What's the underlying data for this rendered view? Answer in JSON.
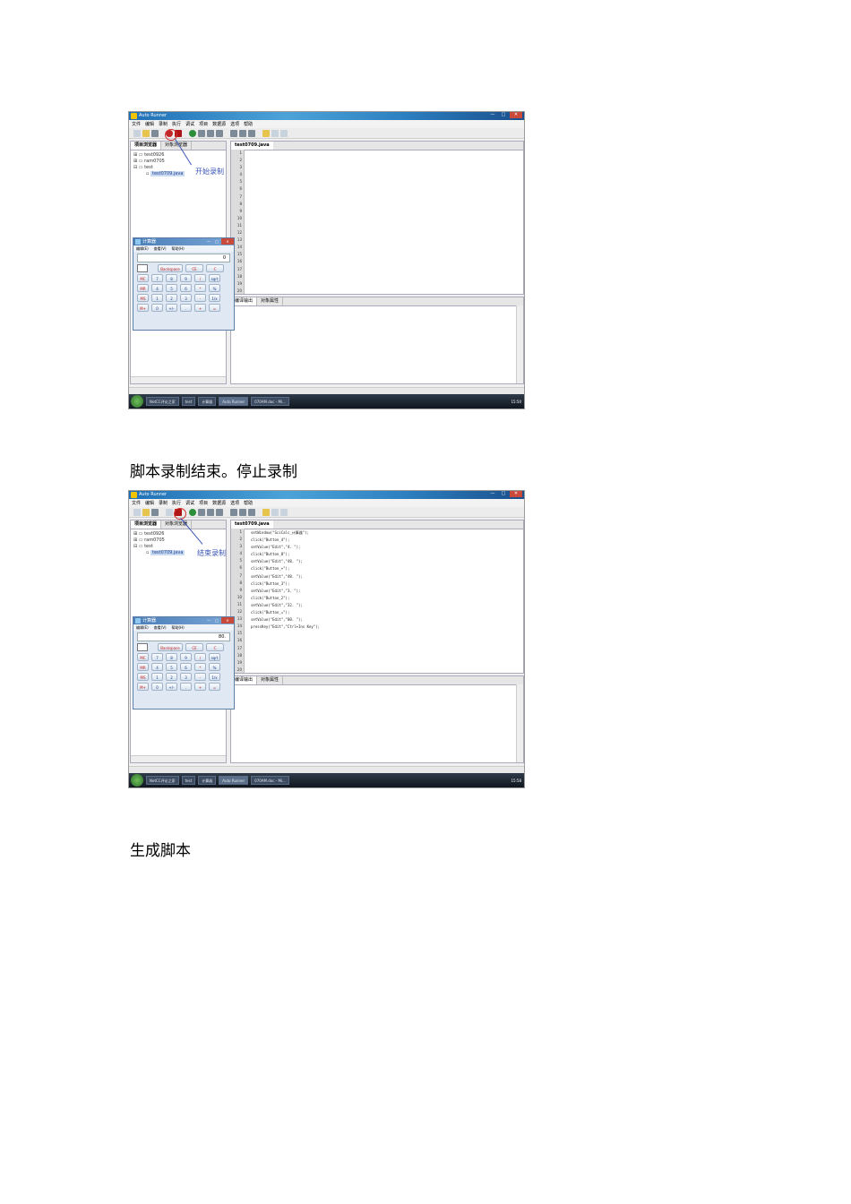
{
  "screenshots": [
    {
      "app_title": "Auto Runner",
      "window_buttons": [
        "—",
        "□",
        "✕"
      ],
      "menu": [
        "文件",
        "编辑",
        "录制",
        "执行",
        "调试",
        "项目",
        "数据源",
        "选项",
        "帮助"
      ],
      "left_tabs": [
        "项目浏览器",
        "对象浏览器"
      ],
      "tree": [
        "test0926",
        "ram0705",
        "test",
        "test0709.java"
      ],
      "editor_tab": "test0709.java",
      "line_numbers": [
        "1",
        "2",
        "3",
        "4",
        "5",
        "6",
        "7",
        "8",
        "9",
        "10",
        "11",
        "12",
        "13",
        "14",
        "15",
        "16",
        "17",
        "18",
        "19",
        "20"
      ],
      "code_lines": [],
      "output_tabs": [
        "编译输出",
        "对象属性"
      ],
      "annotation": "开始录制",
      "calculator": {
        "title": "计算器",
        "menu": [
          "编辑(E)",
          "查看(V)",
          "帮助(H)"
        ],
        "display": "0",
        "row0": [
          "Backspace",
          "CE",
          "C"
        ],
        "rows": [
          [
            "MC",
            "7",
            "8",
            "9",
            "/",
            "sqrt"
          ],
          [
            "MR",
            "4",
            "5",
            "6",
            "*",
            "%"
          ],
          [
            "MS",
            "1",
            "2",
            "3",
            "-",
            "1/x"
          ],
          [
            "M+",
            "0",
            "+/-",
            ".",
            "+",
            "="
          ]
        ]
      },
      "taskbar": [
        "NetCC评论之家",
        "test",
        "计算器",
        "Auto Runner",
        "070AM.doc - Mi..."
      ],
      "clock": "15:50"
    },
    {
      "app_title": "Auto Runner",
      "window_buttons": [
        "—",
        "□",
        "✕"
      ],
      "menu": [
        "文件",
        "编辑",
        "录制",
        "执行",
        "调试",
        "项目",
        "数据源",
        "选项",
        "帮助"
      ],
      "left_tabs": [
        "项目浏览器",
        "对象浏览器"
      ],
      "tree": [
        "test0926",
        "ram0705",
        "test",
        "test0709.java"
      ],
      "editor_tab": "test0709.java",
      "line_numbers": [
        "1",
        "2",
        "3",
        "4",
        "5",
        "6",
        "7",
        "8",
        "9",
        "10",
        "11",
        "12",
        "13",
        "14",
        "15",
        "16",
        "17",
        "18",
        "19",
        "20"
      ],
      "code_lines": [
        "setWindow(\"SciCalc_计算器\");",
        "click(\"Button_4\");",
        "setValue(\"Edit\",\"4. \");",
        "click(\"Button_8\");",
        "setValue(\"Edit\",\"48. \");",
        "click(\"Button_+\");",
        "setValue(\"Edit\",\"48. \");",
        "click(\"Button_3\");",
        "setValue(\"Edit\",\"3. \");",
        "click(\"Button_2\");",
        "setValue(\"Edit\",\"32. \");",
        "click(\"Button_=\");",
        "setValue(\"Edit\",\"80. \");",
        "pressKey(\"Edit\",\"Ctrl+Ins Key\");"
      ],
      "output_tabs": [
        "编译输出",
        "对象属性"
      ],
      "annotation": "结束录制",
      "calculator": {
        "title": "计算器",
        "menu": [
          "编辑(E)",
          "查看(V)",
          "帮助(H)"
        ],
        "display": "80.",
        "row0": [
          "Backspace",
          "CE",
          "C"
        ],
        "rows": [
          [
            "MC",
            "7",
            "8",
            "9",
            "/",
            "sqrt"
          ],
          [
            "MR",
            "4",
            "5",
            "6",
            "*",
            "%"
          ],
          [
            "MS",
            "1",
            "2",
            "3",
            "-",
            "1/x"
          ],
          [
            "M+",
            "0",
            "+/-",
            ".",
            "+",
            "="
          ]
        ]
      },
      "taskbar": [
        "NetCC评论之家",
        "test",
        "计算器",
        "Auto Runner",
        "070AM.doc - Mi..."
      ],
      "clock": "15:58"
    }
  ],
  "captions": {
    "after_first": "脚本录制结束。停止录制",
    "after_second": "生成脚本"
  }
}
